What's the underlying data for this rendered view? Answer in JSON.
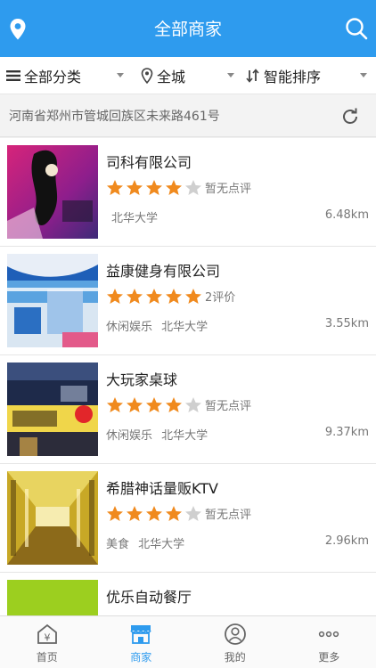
{
  "header": {
    "title": "全部商家"
  },
  "filters": {
    "category": "全部分类",
    "area": "全城",
    "sort": "智能排序"
  },
  "address": "河南省郑州市管城回族区未来路461号",
  "colors": {
    "primary": "#2e9bee",
    "star_on": "#f08a1e",
    "star_off": "#cfcfcf"
  },
  "shops": [
    {
      "name": "司科有限公司",
      "rating": 4,
      "reviews": "暂无点评",
      "tags": [
        "北华大学"
      ],
      "distance": "6.48km"
    },
    {
      "name": "益康健身有限公司",
      "rating": 5,
      "reviews": "2评价",
      "tags": [
        "休闲娱乐",
        "北华大学"
      ],
      "distance": "3.55km"
    },
    {
      "name": "大玩家桌球",
      "rating": 4,
      "reviews": "暂无点评",
      "tags": [
        "休闲娱乐",
        "北华大学"
      ],
      "distance": "9.37km"
    },
    {
      "name": "希腊神话量贩KTV",
      "rating": 4,
      "reviews": "暂无点评",
      "tags": [
        "美食",
        "北华大学"
      ],
      "distance": "2.96km"
    },
    {
      "name": "优乐自动餐厅",
      "rating": 0,
      "reviews": "",
      "tags": [],
      "distance": ""
    }
  ],
  "tabs": [
    {
      "label": "首页",
      "icon": "home-icon"
    },
    {
      "label": "商家",
      "icon": "store-icon"
    },
    {
      "label": "我的",
      "icon": "user-icon"
    },
    {
      "label": "更多",
      "icon": "more-icon"
    }
  ]
}
